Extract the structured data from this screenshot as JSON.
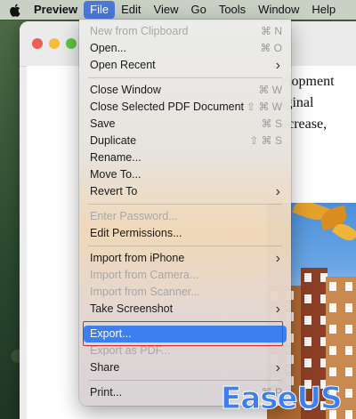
{
  "menubar": {
    "app": "Preview",
    "items": [
      "File",
      "Edit",
      "View",
      "Go",
      "Tools",
      "Window",
      "Help"
    ]
  },
  "document": {
    "lines": [
      "elopment",
      "iginal",
      "ecrease,"
    ]
  },
  "file_menu": {
    "groups": [
      [
        {
          "label": "New from Clipboard",
          "shortcut": "⌘ N",
          "disabled": true
        },
        {
          "label": "Open...",
          "shortcut": "⌘ O"
        },
        {
          "label": "Open Recent",
          "submenu": true
        }
      ],
      [
        {
          "label": "Close Window",
          "shortcut": "⌘ W"
        },
        {
          "label": "Close Selected PDF Document",
          "shortcut": "⇧ ⌘ W"
        },
        {
          "label": "Save",
          "shortcut": "⌘ S"
        },
        {
          "label": "Duplicate",
          "shortcut": "⇧ ⌘ S"
        },
        {
          "label": "Rename..."
        },
        {
          "label": "Move To..."
        },
        {
          "label": "Revert To",
          "submenu": true
        }
      ],
      [
        {
          "label": "Enter Password...",
          "disabled": true
        },
        {
          "label": "Edit Permissions..."
        }
      ],
      [
        {
          "label": "Import from iPhone",
          "submenu": true
        },
        {
          "label": "Import from Camera...",
          "disabled": true
        },
        {
          "label": "Import from Scanner...",
          "disabled": true
        },
        {
          "label": "Take Screenshot",
          "submenu": true
        }
      ],
      [
        {
          "label": "Export...",
          "highlighted": true
        },
        {
          "label": "Export as PDF...",
          "disabled": true
        },
        {
          "label": "Share",
          "submenu": true
        }
      ],
      [
        {
          "label": "Print...",
          "shortcut": "⌘ P"
        }
      ]
    ]
  },
  "watermark": {
    "text": "EaseUS"
  },
  "colors": {
    "highlight": "#3d7ef0",
    "annotation_box": "#d9262b"
  }
}
